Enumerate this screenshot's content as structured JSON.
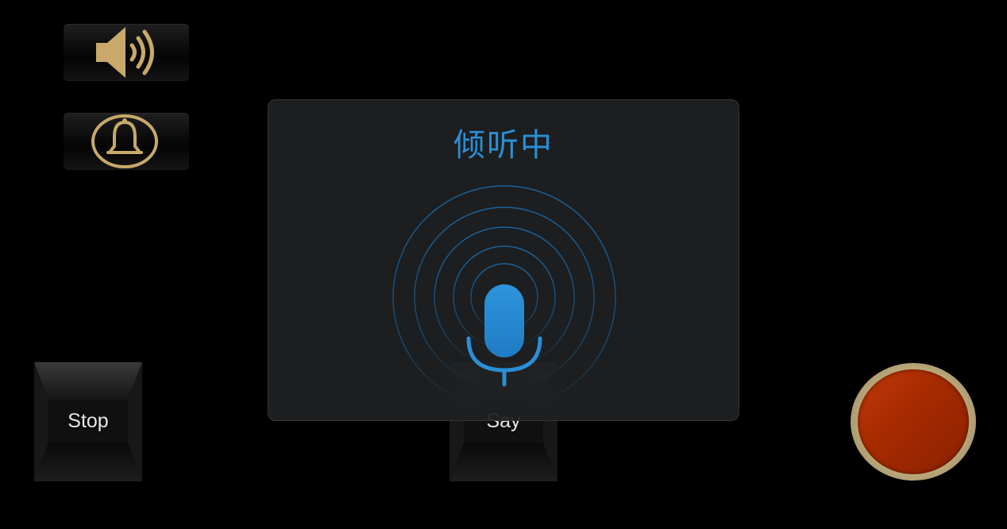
{
  "app": {
    "buttons": {
      "sound": {
        "icon": "speaker-icon"
      },
      "bell": {
        "icon": "bell-icon"
      },
      "stop_label": "Stop",
      "say_label": "Say",
      "record": {
        "icon": "record-button-red"
      }
    }
  },
  "dialog": {
    "title": "倾听中",
    "icon": "microphone-icon",
    "accent_color": "#2a8fd6"
  },
  "colors": {
    "background": "#000000",
    "gold": "#c8a96a",
    "record_red": "#a52a00",
    "mic_blue": "#2a8fd6"
  }
}
